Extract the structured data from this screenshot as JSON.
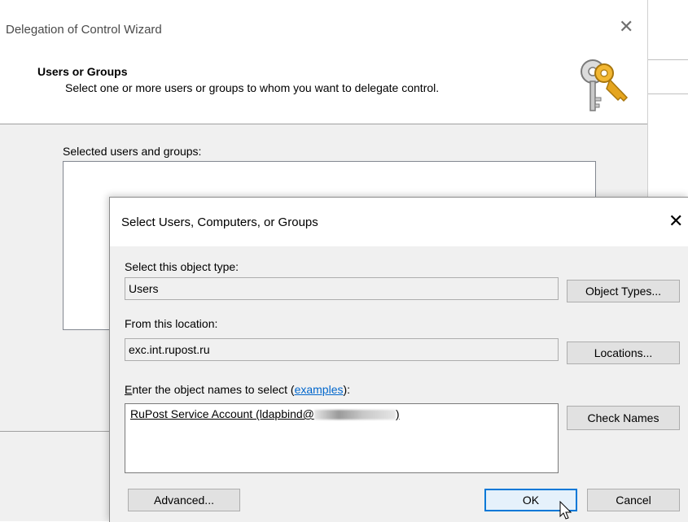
{
  "wizard": {
    "title": "Delegation of Control Wizard",
    "header_title": "Users or Groups",
    "header_subtitle": "Select one or more users or groups to whom you want to delegate control.",
    "selected_label": "Selected users and groups:",
    "close_glyph": "✕",
    "header_icon": "keys-icon"
  },
  "dialog": {
    "title": "Select Users, Computers, or Groups",
    "close_glyph": "✕",
    "object_type_label": "Select this object type:",
    "object_type_value": "Users",
    "object_types_button": "Object Types...",
    "location_label": "From this location:",
    "location_value": "exc.int.rupost.ru",
    "locations_button": "Locations...",
    "names_label_accel": "E",
    "names_label_rest": "nter the object names to select (",
    "examples_link": "examples",
    "names_label_end": "):",
    "names_value_start": "RuPost Service Account (ldapbind@",
    "names_value_end": ")",
    "check_names_button": "Check Names",
    "advanced_button": "Advanced...",
    "ok_button": "OK",
    "cancel_button": "Cancel"
  },
  "colors": {
    "accent": "#0078d7",
    "link": "#0066cc",
    "dialog_bg": "#f0f0f0"
  }
}
